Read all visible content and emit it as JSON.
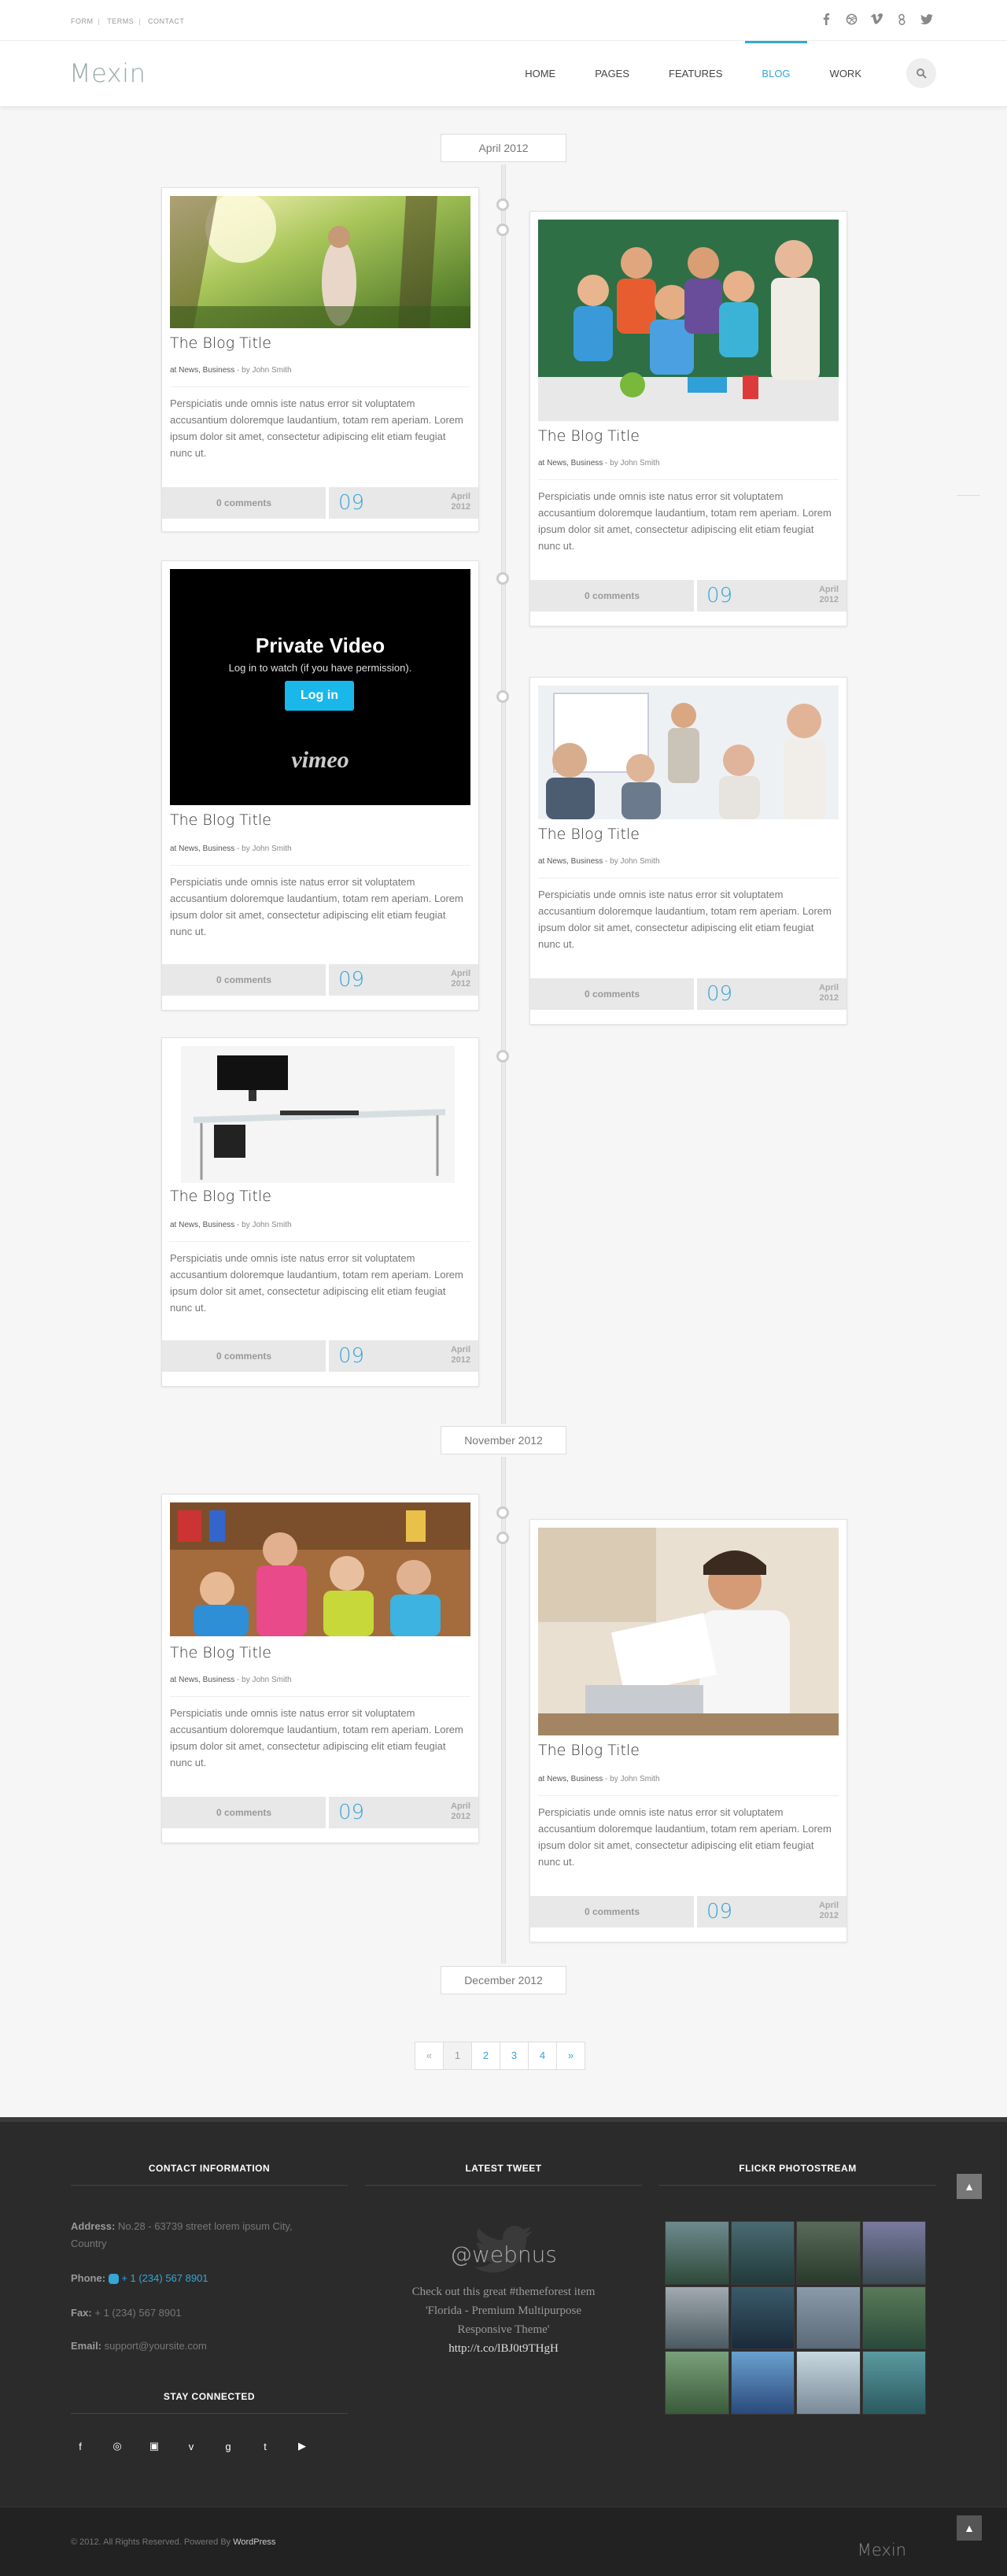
{
  "topbar": {
    "links": [
      "FORM",
      "TERMS",
      "CONTACT"
    ],
    "social_icons": [
      "facebook-icon",
      "dribbble-icon",
      "vimeo-icon",
      "google-plus-icon",
      "twitter-icon"
    ]
  },
  "header": {
    "logo": "Mexin",
    "nav": [
      "HOME",
      "PAGES",
      "FEATURES",
      "BLOG",
      "WORK"
    ],
    "active_nav": "BLOG",
    "search_icon": "search-icon"
  },
  "timeline": {
    "months": [
      "April 2012",
      "November 2012",
      "December 2012"
    ]
  },
  "posts": [
    {
      "title": "The Blog Title",
      "cats": "at News, Business",
      "by": "by John Smith",
      "excerpt": "Perspiciatis unde omnis iste natus error sit voluptatem accusantium doloremque laudantium, totam rem aperiam. Lorem ipsum dolor sit amet, consectetur adipiscing elit etiam feugiat nunc ut.",
      "comments": "0 comments",
      "day": "09",
      "month": "April",
      "year": "2012",
      "image": "woman-in-forest-photo"
    },
    {
      "title": "The Blog Title",
      "cats": "at News, Business",
      "by": "by John Smith",
      "excerpt": "Perspiciatis unde omnis iste natus error sit voluptatem accusantium doloremque laudantium, totam rem aperiam. Lorem ipsum dolor sit amet, consectetur adipiscing elit etiam feugiat nunc ut.",
      "comments": "0 comments",
      "day": "09",
      "month": "April",
      "year": "2012",
      "image": "classroom-kids-photo"
    },
    {
      "title": "The Blog Title",
      "cats": "at News, Business",
      "by": "by John Smith",
      "excerpt": "Perspiciatis unde omnis iste natus error sit voluptatem accusantium doloremque laudantium, totam rem aperiam. Lorem ipsum dolor sit amet, consectetur adipiscing elit etiam feugiat nunc ut.",
      "comments": "0 comments",
      "day": "09",
      "month": "April",
      "year": "2012",
      "image": "vimeo-video"
    },
    {
      "title": "The Blog Title",
      "cats": "at News, Business",
      "by": "by John Smith",
      "excerpt": "Perspiciatis unde omnis iste natus error sit voluptatem accusantium doloremque laudantium, totam rem aperiam. Lorem ipsum dolor sit amet, consectetur adipiscing elit etiam feugiat nunc ut.",
      "comments": "0 comments",
      "day": "09",
      "month": "April",
      "year": "2012",
      "image": "business-meeting-photo"
    },
    {
      "title": "The Blog Title",
      "cats": "at News, Business",
      "by": "by John Smith",
      "excerpt": "Perspiciatis unde omnis iste natus error sit voluptatem accusantium doloremque laudantium, totam rem aperiam. Lorem ipsum dolor sit amet, consectetur adipiscing elit etiam feugiat nunc ut.",
      "comments": "0 comments",
      "day": "09",
      "month": "April",
      "year": "2012",
      "image": "glass-desk-computer-photo"
    },
    {
      "title": "The Blog Title",
      "cats": "at News, Business",
      "by": "by John Smith",
      "excerpt": "Perspiciatis unde omnis iste natus error sit voluptatem accusantium doloremque laudantium, totam rem aperiam. Lorem ipsum dolor sit amet, consectetur adipiscing elit etiam feugiat nunc ut.",
      "comments": "0 comments",
      "day": "09",
      "month": "April",
      "year": "2012",
      "image": "students-library-photo"
    },
    {
      "title": "The Blog Title",
      "cats": "at News, Business",
      "by": "by John Smith",
      "excerpt": "Perspiciatis unde omnis iste natus error sit voluptatem accusantium doloremque laudantium, totam rem aperiam. Lorem ipsum dolor sit amet, consectetur adipiscing elit etiam feugiat nunc ut.",
      "comments": "0 comments",
      "day": "09",
      "month": "April",
      "year": "2012",
      "image": "man-reading-laptop-photo"
    }
  ],
  "video": {
    "title": "Private Video",
    "subtitle": "Log in to watch (if you have permission).",
    "button": "Log in",
    "brand": "vimeo"
  },
  "pagination": {
    "prev": "«",
    "pages": [
      "1",
      "2",
      "3",
      "4"
    ],
    "current": "1",
    "next": "»"
  },
  "footer": {
    "contact_title": "CONTACT INFORMATION",
    "address_label": "Address:",
    "address": "No.28 - 63739 street lorem ipsum City, Country",
    "phone_label": "Phone:",
    "phone": "+ 1 (234) 567 8901",
    "fax_label": "Fax:",
    "fax": "+ 1 (234) 567 8901",
    "email_label": "Email:",
    "email": "support@yoursite.com",
    "stay_title": "STAY CONNECTED",
    "social_icons": [
      "facebook-icon",
      "dribbble-icon",
      "instagram-icon",
      "vimeo-icon",
      "google-plus-icon",
      "twitter-icon",
      "youtube-icon"
    ],
    "tweet_title": "LATEST TWEET",
    "tweet_handle": "@webnus",
    "tweet_line1": "Check out this great #themeforest item",
    "tweet_line2": "'Florida - Premium Multipurpose",
    "tweet_line3": "Responsive Theme'",
    "tweet_link": "http://t.co/lBJ0t9THgH",
    "flickr_title": "FLICKR PHOTOSTREAM",
    "copyright": "© 2012. All Rights Reserved. Powered By",
    "powered": "WordPress",
    "logo": "Mexin"
  },
  "colors": {
    "accent": "#35a6d6",
    "footer_bg": "#2b2b2b"
  }
}
